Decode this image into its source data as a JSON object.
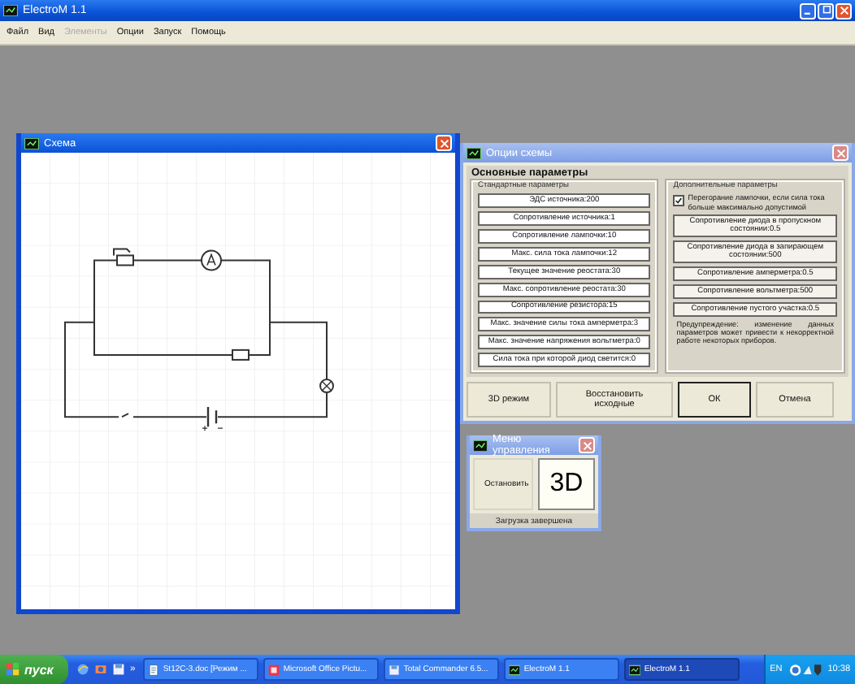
{
  "app": {
    "title": "ElectroM 1.1"
  },
  "menu": [
    {
      "label": "Файл",
      "disabled": false
    },
    {
      "label": "Вид",
      "disabled": false
    },
    {
      "label": "Элементы",
      "disabled": true
    },
    {
      "label": "Опции",
      "disabled": false
    },
    {
      "label": "Запуск",
      "disabled": false
    },
    {
      "label": "Помощь",
      "disabled": false
    }
  ],
  "scheme_window": {
    "title": "Схема"
  },
  "options_dialog": {
    "title": "Опции схемы",
    "heading": "Основные параметры",
    "standard": {
      "title": "Стандартные параметры",
      "buttons": [
        "ЭДС источника:200",
        "Сопротивление источника:1",
        "Сопротивление лампочки:10",
        "Макс. сила тока лампочки:12",
        "Текущее значение реостата:30",
        "Макс. сопротивление реостата:30",
        "Сопротивление резистора:15",
        "Макс. значение силы тока амперметра:3",
        "Макс. значение напряжения вольтметра:0",
        "Сила тока при которой диод светится:0"
      ]
    },
    "extra": {
      "title": "Дополнительные параметры",
      "checkbox": {
        "label": "Перегорание лампочки, если сила тока больше максимально допустимой",
        "checked": true
      },
      "buttons": [
        "Сопротивление диода в пропускном состоянии:0.5",
        "Сопротивление диода в запирающем состоянии:500",
        "Сопротивление амперметра:0.5",
        "Сопротивление вольтметра:500",
        "Сопротивление пустого участка:0.5"
      ],
      "warning": "Предупреждение: изменение данных параметров может привести к некорректной работе некоторых приборов."
    },
    "buttons": [
      {
        "label": "3D режим",
        "focused": false
      },
      {
        "label": "Восстановить исходные",
        "focused": false
      },
      {
        "label": "ОК",
        "focused": true
      },
      {
        "label": "Отмена",
        "focused": false
      }
    ]
  },
  "control_menu": {
    "title": "Меню управления",
    "stop_button": "Остановить",
    "view_button": "3D",
    "status": "Загрузка завершена"
  },
  "taskbar": {
    "start": "пуск",
    "more": "»",
    "tasks": [
      {
        "label": "St12C-3.doc [Режим ...",
        "kind": "document",
        "selected": false
      },
      {
        "label": "Microsoft Office Pictu...",
        "kind": "picture",
        "selected": false
      },
      {
        "label": "Total Commander 6.5...",
        "kind": "disk",
        "selected": false
      },
      {
        "label": "ElectroM 1.1",
        "kind": "app",
        "selected": false
      },
      {
        "label": "ElectroM 1.1",
        "kind": "app",
        "selected": true
      }
    ],
    "language": "EN",
    "clock": "10:38"
  }
}
